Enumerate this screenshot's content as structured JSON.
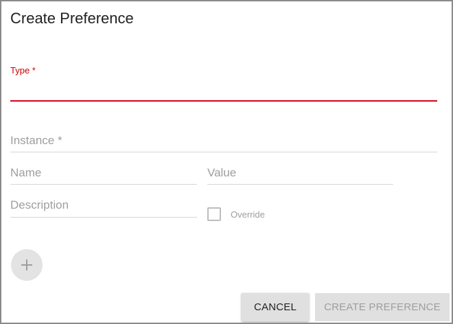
{
  "dialog": {
    "title": "Create Preference"
  },
  "fields": {
    "type": {
      "label": "Type *",
      "value": ""
    },
    "instance": {
      "label": "Instance *",
      "value": ""
    },
    "name": {
      "label": "Name",
      "value": ""
    },
    "value": {
      "label": "Value",
      "value": ""
    },
    "description": {
      "label": "Description",
      "value": ""
    }
  },
  "override": {
    "label": "Override",
    "checked": false
  },
  "add_button": {
    "icon": "plus-icon"
  },
  "actions": {
    "cancel_label": "CANCEL",
    "create_label": "CREATE PREFERENCE"
  },
  "colors": {
    "accent": "#d0021b",
    "disabled_text": "#9e9e9e",
    "button_bg": "#e0e0e0"
  }
}
